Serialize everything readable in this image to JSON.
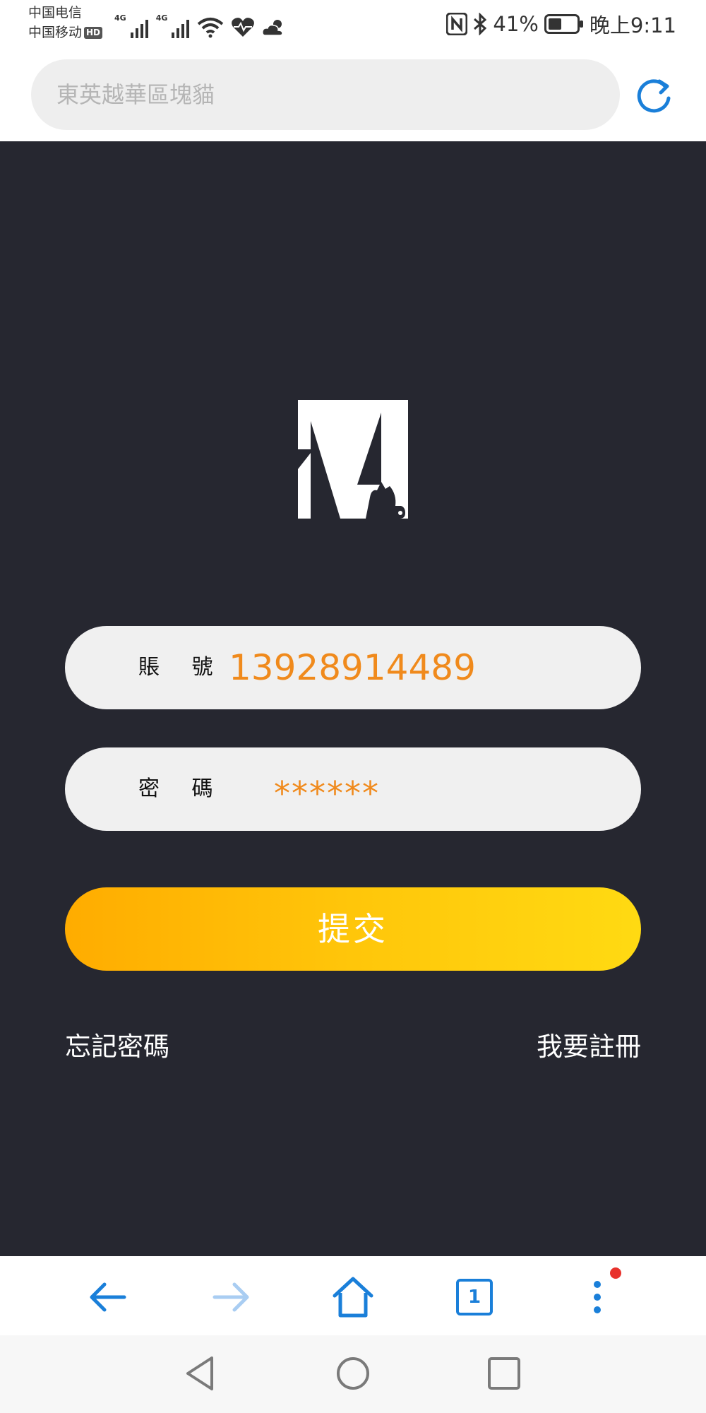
{
  "status_bar": {
    "carrier_1": "中国电信",
    "carrier_2": "中国移动",
    "hd_badge": "HD",
    "network_1": "4G",
    "network_2": "4G",
    "battery_percent": "41%",
    "time": "晚上9:11"
  },
  "address_bar": {
    "url_text": "東英越華區塊貓"
  },
  "login": {
    "logo_letter": "M",
    "account_label": "賬 號",
    "account_value": "13928914489",
    "password_label": "密 碼",
    "password_value": "******",
    "submit_label": "提交",
    "forgot_password": "忘記密碼",
    "register": "我要註冊"
  },
  "browser_nav": {
    "tab_count": "1"
  },
  "colors": {
    "background": "#262730",
    "field_bg": "#f0f0f0",
    "value_orange": "#f08a1c",
    "button_gradient_start": "#ffac00",
    "button_gradient_end": "#ffda12",
    "accent_blue": "#1a7fd9"
  },
  "icons": [
    "signal-icon",
    "wifi-icon",
    "heart-rate-icon",
    "weather-icon",
    "nfc-icon",
    "bluetooth-icon",
    "battery-icon",
    "reload-icon",
    "back-arrow-icon",
    "forward-arrow-icon",
    "home-icon",
    "tabs-icon",
    "menu-dots-icon"
  ]
}
